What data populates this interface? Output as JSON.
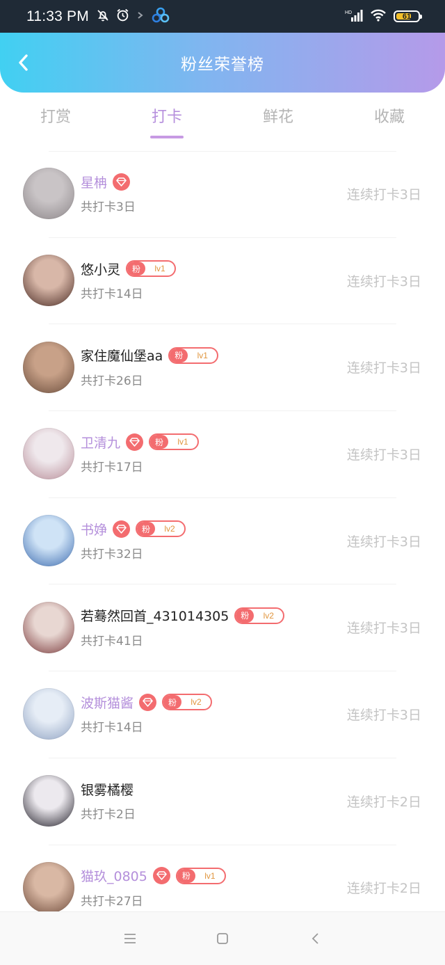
{
  "status_bar": {
    "time": "11:33 PM",
    "battery": "61",
    "battery_fraction": 0.61,
    "icons": [
      "mute-bell-icon",
      "alarm-icon",
      "chevron-icon",
      "baidu-app-icon",
      "signal-icon",
      "wifi-icon",
      "battery-icon"
    ]
  },
  "header": {
    "title": "粉丝荣誉榜"
  },
  "tabs": [
    {
      "label": "打赏",
      "active": false
    },
    {
      "label": "打卡",
      "active": true
    },
    {
      "label": "鲜花",
      "active": false
    },
    {
      "label": "收藏",
      "active": false
    }
  ],
  "rows": [
    {
      "name": "星柟",
      "vip": true,
      "gem": true,
      "fan_tag": "",
      "fan_level": "",
      "count": "共打卡3日",
      "streak": "连续打卡3日",
      "avatar_colors": [
        "#c9c4c6",
        "#8c8689"
      ]
    },
    {
      "name": "悠小灵",
      "vip": false,
      "gem": false,
      "fan_tag": "粉",
      "fan_level": "lv1",
      "count": "共打卡14日",
      "streak": "连续打卡3日",
      "avatar_colors": [
        "#d8b7a8",
        "#4a2b24"
      ]
    },
    {
      "name": "家住魔仙堡aa",
      "vip": false,
      "gem": false,
      "fan_tag": "粉",
      "fan_level": "lv1",
      "count": "共打卡26日",
      "streak": "连续打卡3日",
      "avatar_colors": [
        "#c8a188",
        "#6b4d3c"
      ]
    },
    {
      "name": "卫清九",
      "vip": true,
      "gem": true,
      "fan_tag": "粉",
      "fan_level": "lv1",
      "count": "共打卡17日",
      "streak": "连续打卡3日",
      "avatar_colors": [
        "#efe8ec",
        "#b88d98"
      ]
    },
    {
      "name": "书婙",
      "vip": true,
      "gem": true,
      "fan_tag": "粉",
      "fan_level": "lv2",
      "count": "共打卡32日",
      "streak": "连续打卡3日",
      "avatar_colors": [
        "#cfe3f6",
        "#3d6cb0"
      ]
    },
    {
      "name": "若蓦然回首_431014305",
      "vip": false,
      "gem": false,
      "fan_tag": "粉",
      "fan_level": "lv2",
      "count": "共打卡41日",
      "streak": "连续打卡3日",
      "avatar_colors": [
        "#e8d7d2",
        "#7b3a3c"
      ]
    },
    {
      "name": "波斯猫酱",
      "vip": true,
      "gem": true,
      "fan_tag": "粉",
      "fan_level": "lv2",
      "count": "共打卡14日",
      "streak": "连续打卡3日",
      "avatar_colors": [
        "#e6edf6",
        "#8fa2c2"
      ]
    },
    {
      "name": "银雾橘樱",
      "vip": false,
      "gem": false,
      "fan_tag": "",
      "fan_level": "",
      "count": "共打卡2日",
      "streak": "连续打卡2日",
      "avatar_colors": [
        "#ece9ee",
        "#23202a"
      ]
    },
    {
      "name": "猫玖_0805",
      "vip": true,
      "gem": true,
      "fan_tag": "粉",
      "fan_level": "lv1",
      "count": "共打卡27日",
      "streak": "连续打卡2日",
      "avatar_colors": [
        "#d9b8a4",
        "#6e4a3a"
      ]
    }
  ],
  "nav_bar": {
    "buttons": [
      "menu-icon",
      "home-icon",
      "back-icon"
    ]
  }
}
